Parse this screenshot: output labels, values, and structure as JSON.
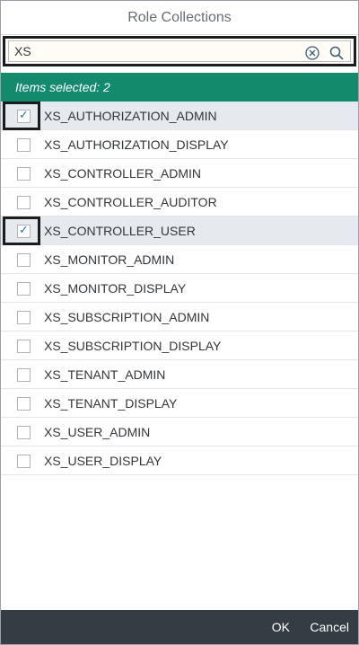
{
  "dialog": {
    "title": "Role Collections"
  },
  "search": {
    "value": "XS"
  },
  "selection": {
    "info": "Items selected: 2"
  },
  "items": [
    {
      "label": "XS_AUTHORIZATION_ADMIN",
      "checked": true
    },
    {
      "label": "XS_AUTHORIZATION_DISPLAY",
      "checked": false
    },
    {
      "label": "XS_CONTROLLER_ADMIN",
      "checked": false
    },
    {
      "label": "XS_CONTROLLER_AUDITOR",
      "checked": false
    },
    {
      "label": "XS_CONTROLLER_USER",
      "checked": true
    },
    {
      "label": "XS_MONITOR_ADMIN",
      "checked": false
    },
    {
      "label": "XS_MONITOR_DISPLAY",
      "checked": false
    },
    {
      "label": "XS_SUBSCRIPTION_ADMIN",
      "checked": false
    },
    {
      "label": "XS_SUBSCRIPTION_DISPLAY",
      "checked": false
    },
    {
      "label": "XS_TENANT_ADMIN",
      "checked": false
    },
    {
      "label": "XS_TENANT_DISPLAY",
      "checked": false
    },
    {
      "label": "XS_USER_ADMIN",
      "checked": false
    },
    {
      "label": "XS_USER_DISPLAY",
      "checked": false
    }
  ],
  "footer": {
    "ok_label": "OK",
    "cancel_label": "Cancel"
  },
  "colors": {
    "info_bar": "#138a6c",
    "footer": "#353d44",
    "selected_row": "#e5eaee"
  },
  "icons": {
    "clear": "clear-circle-icon",
    "search": "search-icon",
    "check": "checkmark-icon"
  }
}
